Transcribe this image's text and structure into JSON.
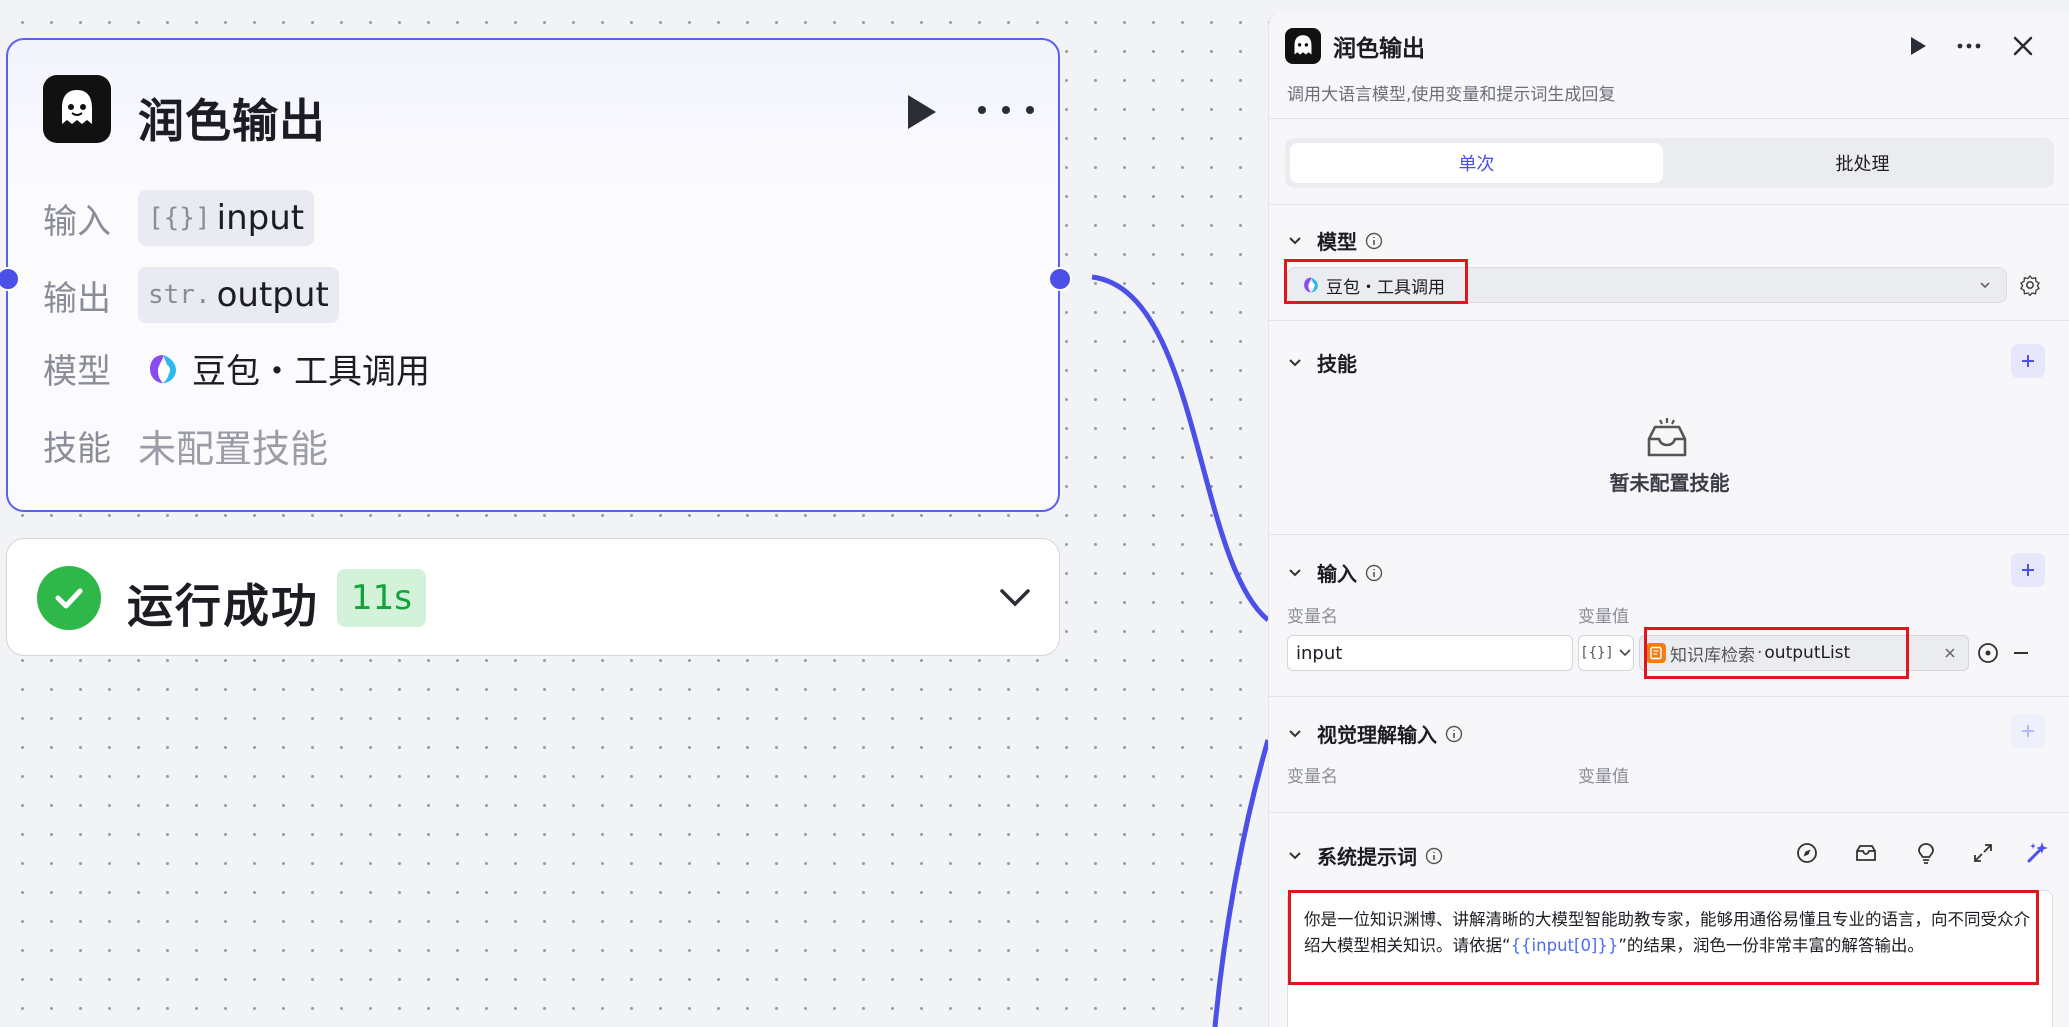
{
  "node": {
    "title": "润色输出",
    "rows": [
      {
        "label": "输入",
        "type_tag": "[{}]",
        "value": "input"
      },
      {
        "label": "输出",
        "type_tag": "str.",
        "value": "output"
      },
      {
        "label": "模型",
        "value": "豆包・工具调用"
      },
      {
        "label": "技能",
        "value": "未配置技能"
      }
    ]
  },
  "status": {
    "text": "运行成功",
    "duration": "11s",
    "color": "#2eb84a"
  },
  "panel": {
    "title": "润色输出",
    "description": "调用大语言模型,使用变量和提示词生成回复",
    "tabs": [
      {
        "label": "单次",
        "active": true
      },
      {
        "label": "批处理",
        "active": false
      }
    ],
    "model_section": {
      "title": "模型",
      "selected": "豆包・工具调用"
    },
    "skill_section": {
      "title": "技能",
      "empty_text": "暂未配置技能"
    },
    "input_section": {
      "title": "输入",
      "col_name": "变量名",
      "col_value": "变量值",
      "variable": {
        "name": "input",
        "type_tag": "[{}]",
        "source": "知识库检索",
        "separator": "·",
        "ref": "outputList"
      }
    },
    "vision_section": {
      "title": "视觉理解输入",
      "col_name": "变量名",
      "col_value": "变量值"
    },
    "system_prompt": {
      "title": "系统提示词",
      "text_before": "你是一位知识渊博、讲解清晰的大模型智能助教专家，能够用通俗易懂且专业的语言，向不同受众介绍大模型相关知识。请依据“",
      "variable": "{{input[0]}}",
      "text_after": "”的结果，润色一份非常丰富的解答输出。"
    }
  },
  "colors": {
    "accent": "#4c50e8",
    "highlight": "#e0161e",
    "success": "#2eb84a"
  }
}
